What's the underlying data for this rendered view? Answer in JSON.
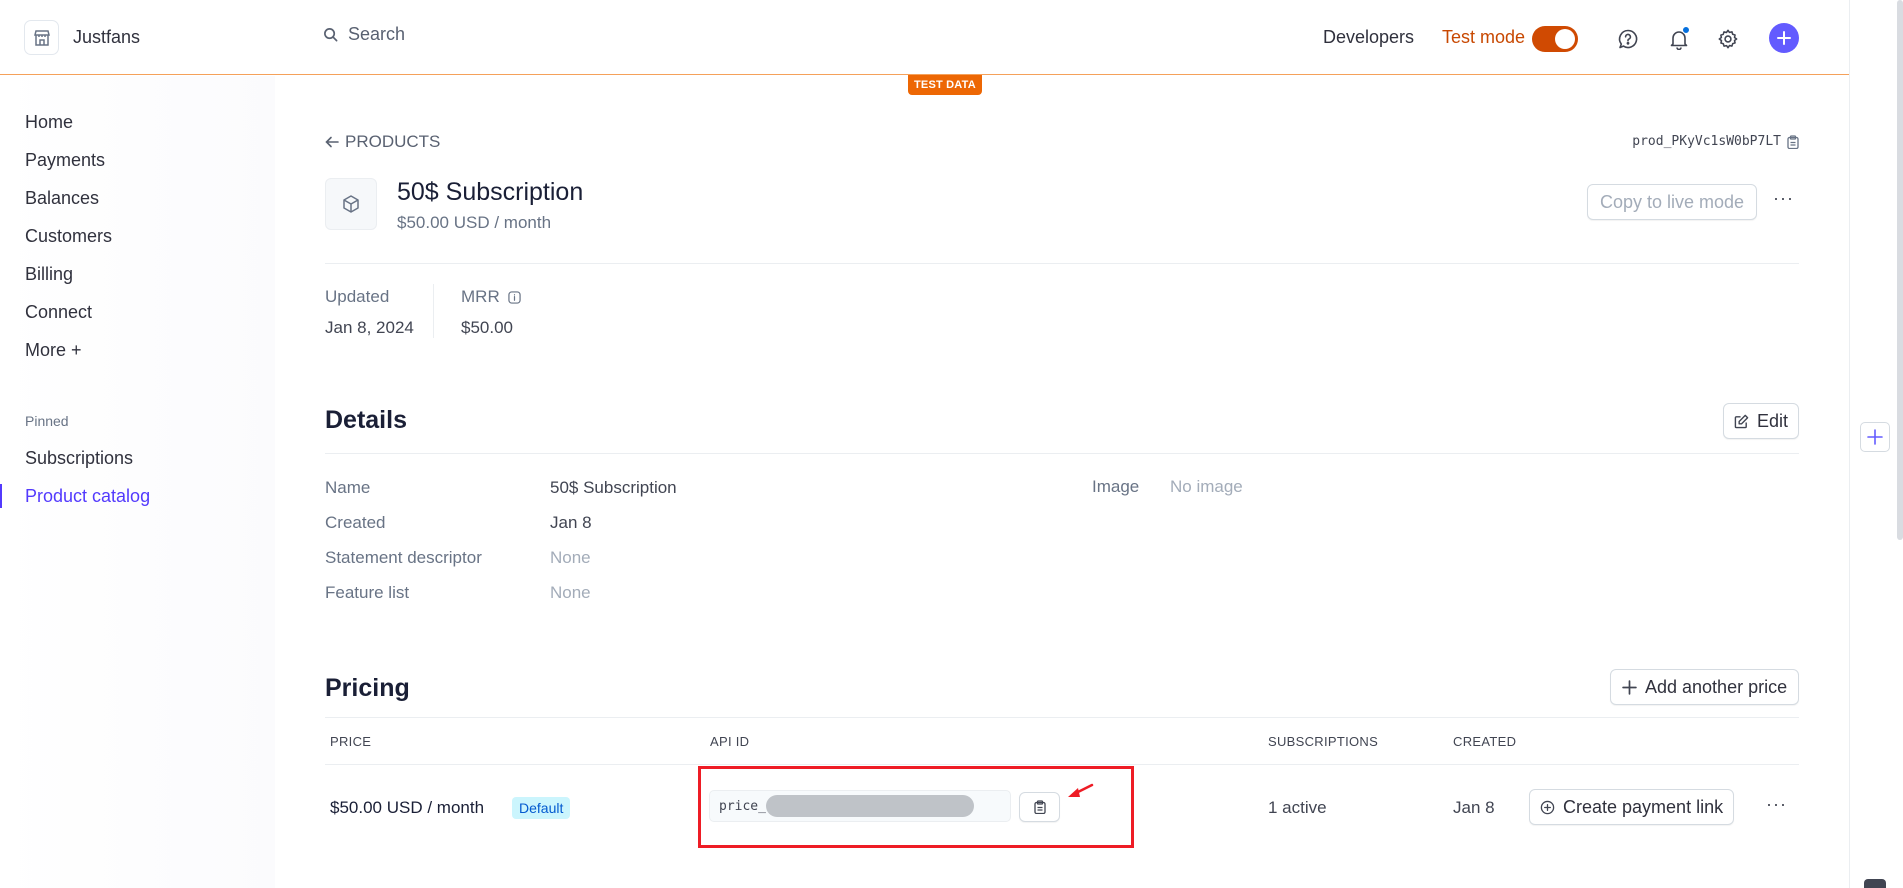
{
  "topbar": {
    "brand": "Justfans",
    "search_placeholder": "Search",
    "developers": "Developers",
    "test_mode": "Test mode",
    "test_badge": "TEST DATA",
    "icons": [
      "help-icon",
      "bell-icon",
      "gear-icon",
      "plus-icon"
    ],
    "accent_color": "#635bff",
    "test_color": "#ed6704"
  },
  "sidebar": {
    "items": [
      {
        "label": "Home"
      },
      {
        "label": "Payments"
      },
      {
        "label": "Balances"
      },
      {
        "label": "Customers"
      },
      {
        "label": "Billing"
      },
      {
        "label": "Connect"
      },
      {
        "label": "More +"
      }
    ],
    "pinned_label": "Pinned",
    "pinned": [
      {
        "label": "Subscriptions"
      },
      {
        "label": "Product catalog",
        "active": true
      }
    ]
  },
  "product": {
    "back_label": "PRODUCTS",
    "id": "prod_PKyVc1sW0bP7LT",
    "title": "50$ Subscription",
    "subtitle": "$50.00 USD / month",
    "copy_live": "Copy to live mode",
    "stats": {
      "updated_label": "Updated",
      "updated_value": "Jan 8, 2024",
      "mrr_label": "MRR",
      "mrr_value": "$50.00"
    }
  },
  "details": {
    "title": "Details",
    "edit": "Edit",
    "rows": [
      {
        "label": "Name",
        "value": "50$ Subscription"
      },
      {
        "label": "Created",
        "value": "Jan 8"
      },
      {
        "label": "Statement descriptor",
        "value": "None"
      },
      {
        "label": "Feature list",
        "value": "None"
      }
    ],
    "image_label": "Image",
    "image_value": "No image"
  },
  "pricing": {
    "title": "Pricing",
    "add_price": "Add another price",
    "columns": [
      "PRICE",
      "API ID",
      "SUBSCRIPTIONS",
      "CREATED"
    ],
    "row": {
      "price": "$50.00 USD / month",
      "badge": "Default",
      "api_prefix": "price_",
      "subscriptions": "1 active",
      "created": "Jan 8",
      "payment_link": "Create payment link"
    }
  }
}
